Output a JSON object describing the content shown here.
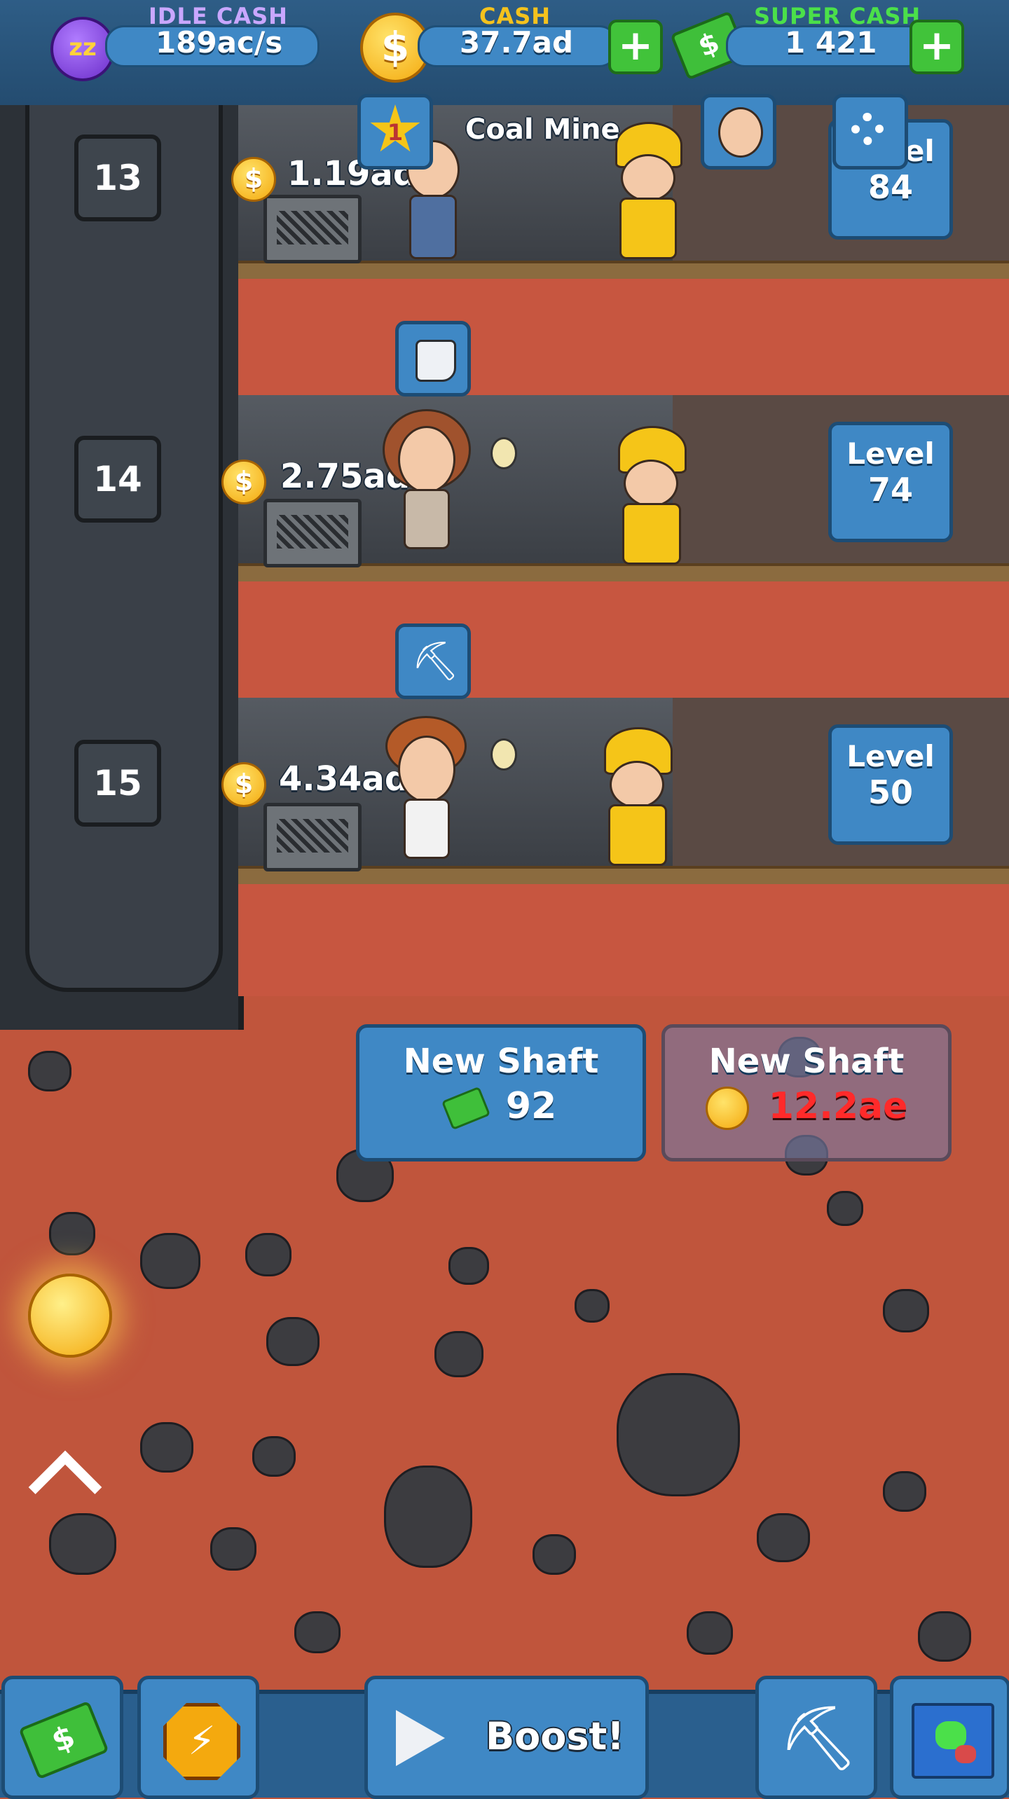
{
  "top_bar": {
    "idle_cash": {
      "label": "IDLE CASH",
      "value": "189ac/s",
      "icon": "zzz-coin-icon"
    },
    "cash": {
      "label": "CASH",
      "value": "37.7ad",
      "icon": "coin-icon"
    },
    "super_cash": {
      "label": "SUPER CASH",
      "value": "1 421",
      "icon": "super-cash-icon"
    }
  },
  "mine": {
    "name": "Coal Mine",
    "prestige_level": "1"
  },
  "shafts": [
    {
      "number": "13",
      "stored": "1.19ad",
      "level_label": "Level",
      "level": "84",
      "upgrade_icon": "glove-icon"
    },
    {
      "number": "14",
      "stored": "2.75ad",
      "level_label": "Level",
      "level": "74",
      "upgrade_icon": "pickaxe-icon"
    },
    {
      "number": "15",
      "stored": "4.34ad",
      "level_label": "Level",
      "level": "50",
      "upgrade_icon": ""
    }
  ],
  "new_shaft_buttons": [
    {
      "label": "New Shaft",
      "price": "92",
      "currency_icon": "super-cash-icon",
      "affordable": true
    },
    {
      "label": "New Shaft",
      "price": "12.2ae",
      "currency_icon": "coin-icon",
      "affordable": false
    }
  ],
  "bottom_bar": {
    "boost_label": "Boost!",
    "buttons": [
      "shop-cash-icon",
      "boost-shield-icon",
      "boost-play-icon",
      "pickaxe-shovel-icon",
      "map-icon"
    ]
  },
  "colors": {
    "cash_label": "#f4c21d",
    "super_cash_label": "#4be04a",
    "idle_label": "#c9a7ff",
    "unaffordable_price": "#ff2a2a",
    "dirt": "#c75640"
  }
}
